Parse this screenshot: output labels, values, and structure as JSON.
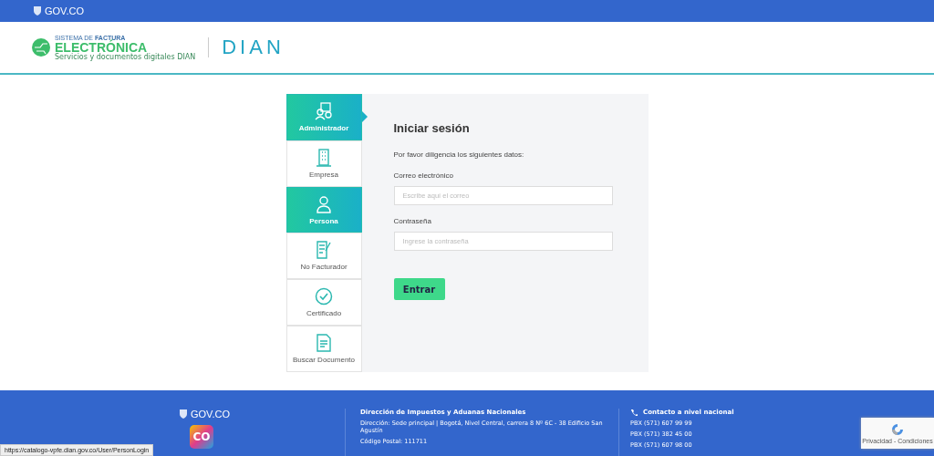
{
  "top_bar": {
    "brand": "GOV.CO"
  },
  "header": {
    "logo_line1": "SISTEMA DE ",
    "logo_line1_bold": "FACTURA",
    "logo_line2": "ELECTRÓNICA",
    "logo_line3": "Servicios y documentos digitales DIAN",
    "dian": "DIAN"
  },
  "sidebar": {
    "items": [
      {
        "label": "Administrador",
        "selected": true,
        "hovered": false
      },
      {
        "label": "Empresa",
        "selected": false,
        "hovered": false
      },
      {
        "label": "Persona",
        "selected": false,
        "hovered": true
      },
      {
        "label": "No Facturador",
        "selected": false,
        "hovered": false
      },
      {
        "label": "Certificado",
        "selected": false,
        "hovered": false
      },
      {
        "label": "Buscar Documento",
        "selected": false,
        "hovered": false
      }
    ]
  },
  "login": {
    "title": "Iniciar sesión",
    "intro": "Por favor diligencia los siguientes datos:",
    "fields": [
      {
        "label": "Correo electrónico",
        "placeholder": "Escribe aquí el correo"
      },
      {
        "label": "Contraseña",
        "placeholder": "Ingrese la contraseña"
      }
    ],
    "button": "Entrar"
  },
  "footer": {
    "brand": "GOV.CO",
    "co_logo": "CO",
    "org": "Dirección de Impuestos y Aduanas Nacionales",
    "address": "Dirección: Sede principal | Bogotá, Nivel Central, carrera 8 Nº 6C - 38 Edificio San Agustín",
    "postal": "Código Postal: 111711",
    "contact_title": "Contacto a nivel nacional",
    "phones": [
      "PBX (571) 607 99 99",
      "PBX (571) 382 45 00",
      "PBX (571) 607 98 00"
    ]
  },
  "status_url": "https://catalogo-vpfe.dian.gov.co/User/PersonLogin",
  "recaptcha": "Privacidad - Condiciones"
}
